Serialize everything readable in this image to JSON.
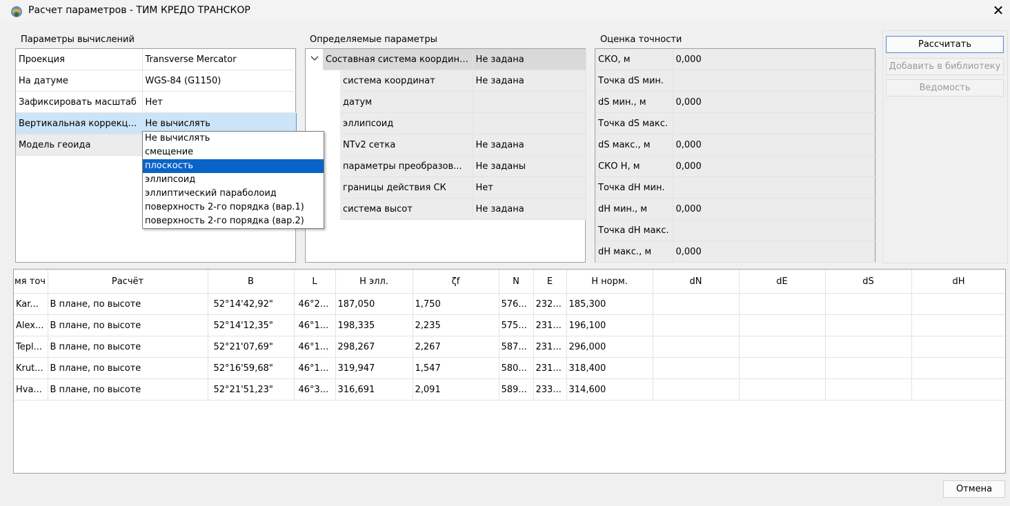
{
  "window": {
    "title": "Расчет параметров - ТИМ КРЕДО ТРАНСКОР",
    "close": "✕"
  },
  "calc_params": {
    "label": "Параметры вычислений",
    "rows": [
      {
        "name": "Проекция",
        "value": "Transverse Mercator"
      },
      {
        "name": "На датуме",
        "value": "WGS-84 (G1150)"
      },
      {
        "name": "Зафиксировать масштаб",
        "value": "Нет"
      },
      {
        "name": "Вертикальная коррекция",
        "value": "Не вычислять"
      },
      {
        "name": "Модель геоида",
        "value": ""
      }
    ],
    "dropdown_options": [
      "Не вычислять",
      "смещение",
      "плоскость",
      "эллипсоид",
      "эллиптический параболоид",
      "поверхность 2-го порядка (вар.1)",
      "поверхность 2-го порядка (вар.2)"
    ],
    "dropdown_selected_index": 2
  },
  "determined_params": {
    "label": "Определяемые параметры",
    "parent": {
      "name": "Составная система координат",
      "value": "Не задана"
    },
    "children": [
      {
        "name": "система координат",
        "value": "Не задана"
      },
      {
        "name": "датум",
        "value": ""
      },
      {
        "name": "эллипсоид",
        "value": ""
      },
      {
        "name": "NTv2 сетка",
        "value": "Не задана"
      },
      {
        "name": "параметры преобразов...",
        "value": "Не заданы"
      },
      {
        "name": "границы действия СК",
        "value": "Нет"
      },
      {
        "name": "система высот",
        "value": "Не задана"
      }
    ]
  },
  "accuracy": {
    "label": "Оценка точности",
    "rows": [
      {
        "name": "СКО, м",
        "value": "0,000"
      },
      {
        "name": "Точка dS мин.",
        "value": ""
      },
      {
        "name": "dS мин., м",
        "value": "0,000"
      },
      {
        "name": "Точка dS макс.",
        "value": ""
      },
      {
        "name": "dS макс., м",
        "value": "0,000"
      },
      {
        "name": "СКО Н, м",
        "value": "0,000"
      },
      {
        "name": "Точка dH мин.",
        "value": ""
      },
      {
        "name": "dH мин., м",
        "value": "0,000"
      },
      {
        "name": "Точка dH макс.",
        "value": ""
      },
      {
        "name": "dH макс., м",
        "value": "0,000"
      }
    ]
  },
  "buttons": {
    "calculate": "Рассчитать",
    "add_library": "Добавить в библиотеку",
    "statement": "Ведомость",
    "cancel": "Отмена"
  },
  "points_table": {
    "columns": [
      "мя точ",
      "Расчёт",
      "B",
      "L",
      "H элл.",
      "ζf",
      "N",
      "E",
      "H норм.",
      "dN",
      "dE",
      "dS",
      "dH"
    ],
    "rows": [
      [
        "Kar...",
        "В плане, по высоте",
        "52°14'42,92\"",
        "46°2...",
        "187,050",
        "1,750",
        "576...",
        "232...",
        "185,300",
        "",
        "",
        "",
        ""
      ],
      [
        "Alex...",
        "В плане, по высоте",
        "52°14'12,35\"",
        "46°1...",
        "198,335",
        "2,235",
        "575...",
        "231...",
        "196,100",
        "",
        "",
        "",
        ""
      ],
      [
        "Tepl...",
        "В плане, по высоте",
        "52°21'07,69\"",
        "46°1...",
        "298,267",
        "2,267",
        "587...",
        "231...",
        "296,000",
        "",
        "",
        "",
        ""
      ],
      [
        "Krut...",
        "В плане, по высоте",
        "52°16'59,68\"",
        "46°1...",
        "319,947",
        "1,547",
        "580...",
        "231...",
        "318,400",
        "",
        "",
        "",
        ""
      ],
      [
        "Hva...",
        "В плане, по высоте",
        "52°21'51,23\"",
        "46°3...",
        "316,691",
        "2,091",
        "589...",
        "233...",
        "314,600",
        "",
        "",
        "",
        ""
      ]
    ]
  },
  "colors": {
    "selection": "#0a64c8",
    "highlight_row": "#cce4f7",
    "parent_row": "#d9d9d9"
  }
}
